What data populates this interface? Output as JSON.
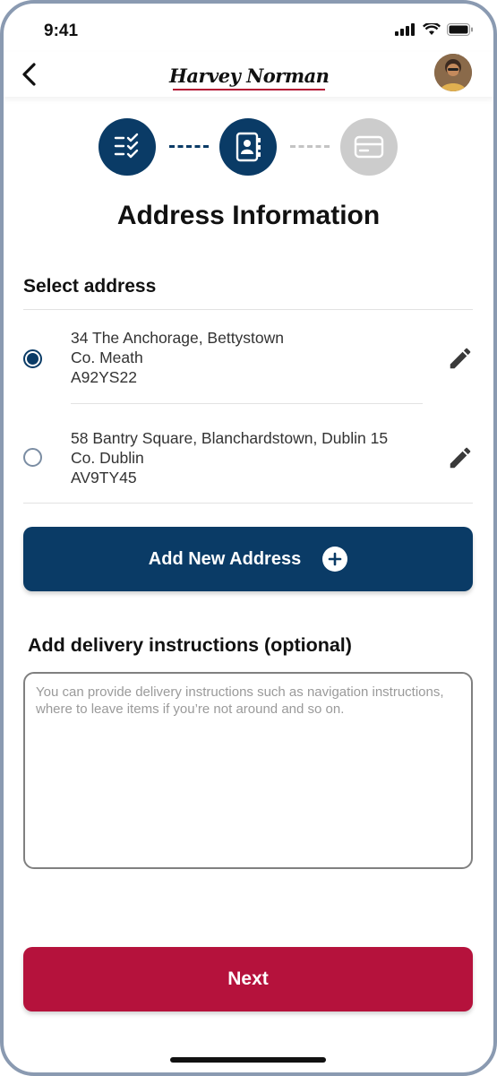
{
  "status_bar": {
    "time": "9:41"
  },
  "header": {
    "brand": "Harvey Norman"
  },
  "steps": [
    {
      "name": "checklist-icon",
      "state": "complete"
    },
    {
      "name": "address-book-icon",
      "state": "current"
    },
    {
      "name": "credit-card-icon",
      "state": "upcoming"
    }
  ],
  "page": {
    "title": "Address Information",
    "section_label": "Select address"
  },
  "addresses": [
    {
      "line1": "34 The Anchorage, Bettystown",
      "line2": "Co. Meath",
      "line3": "A92YS22",
      "selected": true
    },
    {
      "line1": "58 Bantry Square, Blanchardstown, Dublin 15",
      "line2": "Co. Dublin",
      "line3": "AV9TY45",
      "selected": false
    }
  ],
  "add_address": {
    "label": "Add New Address"
  },
  "instructions": {
    "label": "Add delivery instructions (optional)",
    "value": "",
    "placeholder": "You can provide delivery instructions such as navigation instructions, where to leave items if you’re not around and so on."
  },
  "next": {
    "label": "Next"
  },
  "colors": {
    "primary": "#0a3b66",
    "accent": "#b5123c",
    "inactive": "#cccccc"
  }
}
